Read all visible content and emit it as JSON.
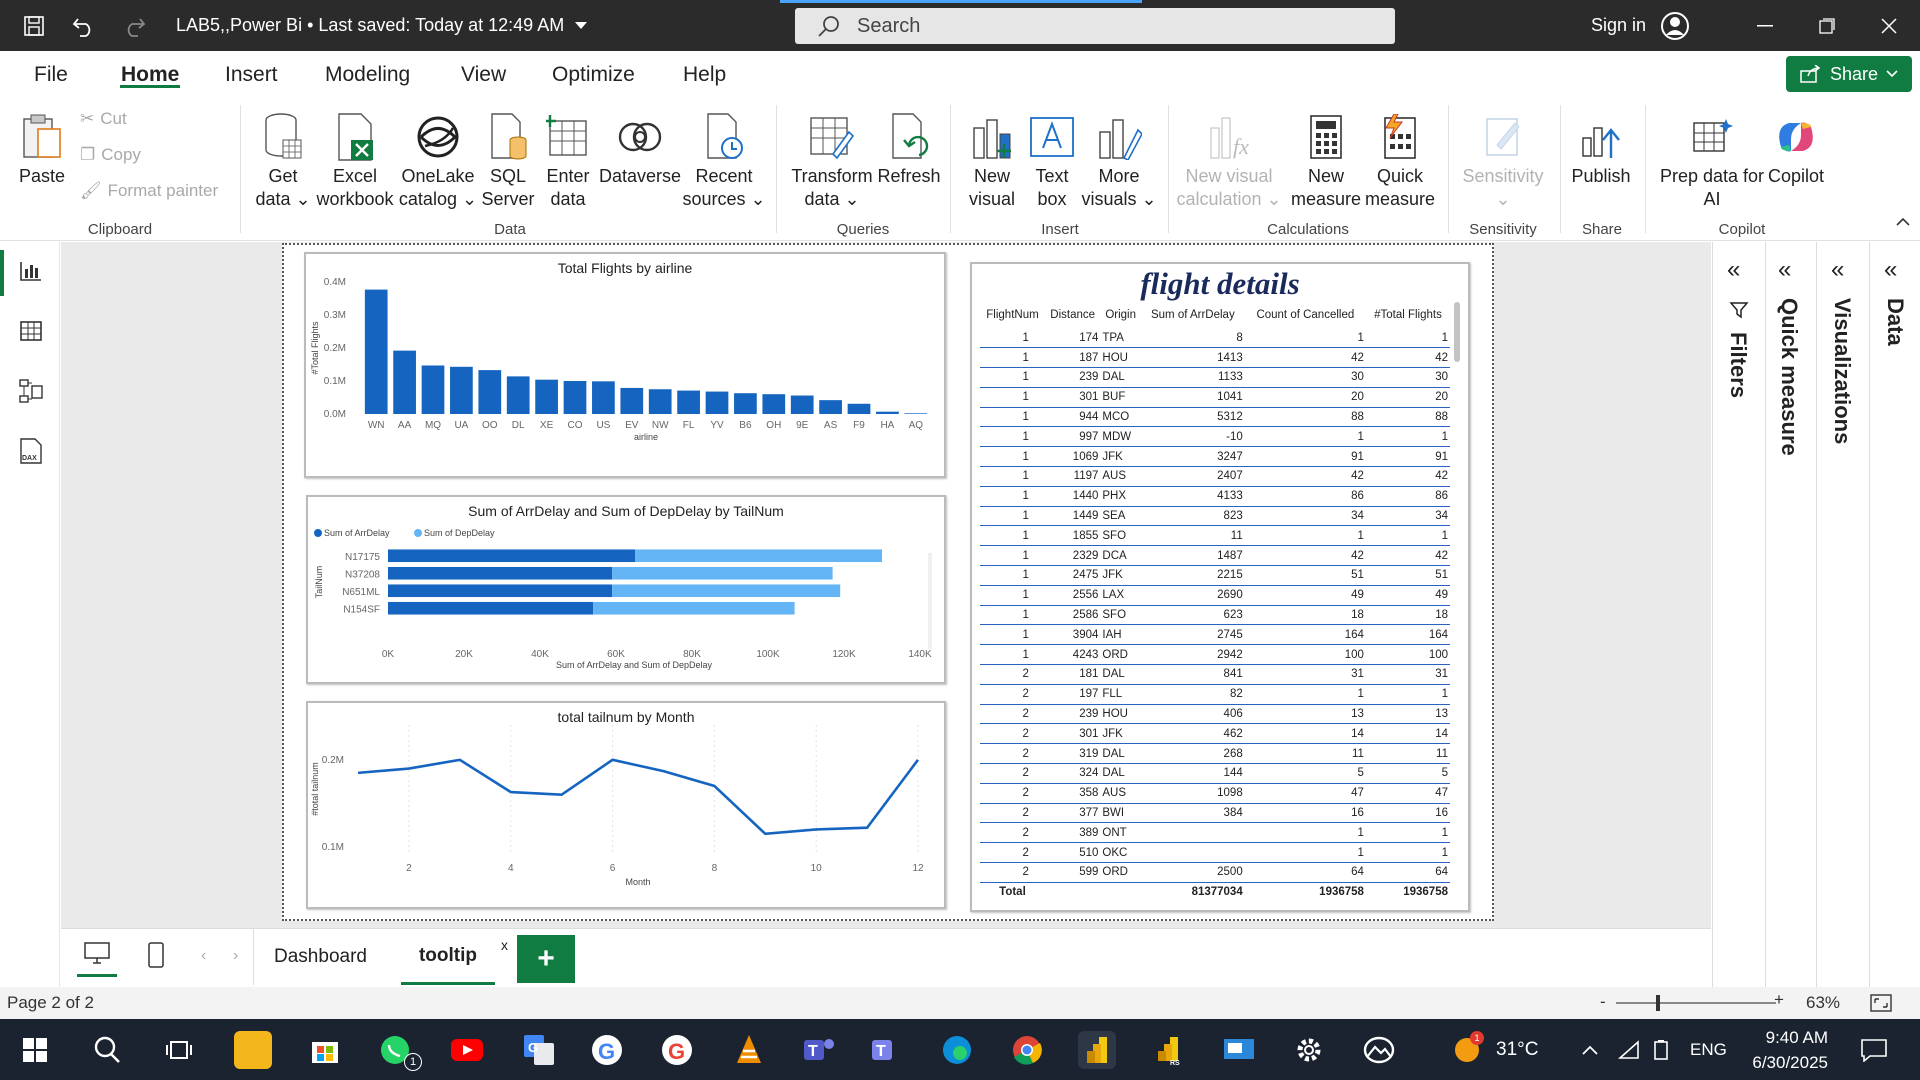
{
  "titlebar": {
    "doc_title": "LAB5,,Power Bi • Last saved: Today at 12:49 AM",
    "search_placeholder": "Search",
    "signin": "Sign in"
  },
  "menu": {
    "items": [
      "File",
      "Home",
      "Insert",
      "Modeling",
      "View",
      "Optimize",
      "Help"
    ],
    "active": "Home",
    "share": "Share"
  },
  "ribbon": {
    "clipboard": {
      "paste": "Paste",
      "cut": "Cut",
      "copy": "Copy",
      "format_painter": "Format painter",
      "group": "Clipboard"
    },
    "data": {
      "get_data": "Get\ndata ⌄",
      "excel": "Excel\nworkbook",
      "onelake": "OneLake\ncatalog ⌄",
      "sql": "SQL\nServer",
      "enter": "Enter\ndata",
      "dataverse": "Dataverse",
      "recent": "Recent\nsources ⌄",
      "group": "Data"
    },
    "queries": {
      "transform": "Transform\ndata ⌄",
      "refresh": "Refresh",
      "group": "Queries"
    },
    "insert": {
      "new_visual": "New\nvisual",
      "text_box": "Text\nbox",
      "more_visuals": "More\nvisuals ⌄",
      "group": "Insert"
    },
    "calculations": {
      "new_visual_calc": "New visual\ncalculation ⌄",
      "new_measure": "New\nmeasure",
      "quick_measure": "Quick\nmeasure",
      "group": "Calculations"
    },
    "sensitivity": {
      "label": "Sensitivity\n⌄",
      "group": "Sensitivity"
    },
    "share": {
      "publish": "Publish",
      "group": "Share"
    },
    "copilot": {
      "prep": "Prep data for\nAI",
      "copilot": "Copilot",
      "group": "Copilot"
    }
  },
  "panes": {
    "filters": "Filters",
    "quick_measure": "Quick measure",
    "visualizations": "Visualizations",
    "data": "Data"
  },
  "colors": {
    "accent": "#107c41",
    "bar_dark": "#1565c0",
    "bar_light": "#64b5f6",
    "table_rule": "#2a62c0"
  },
  "chart_data": [
    {
      "type": "bar",
      "title": "Total Flights by airline",
      "xlabel": "airline",
      "ylabel": "#Total Flights",
      "categories": [
        "WN",
        "AA",
        "MQ",
        "UA",
        "OO",
        "DL",
        "XE",
        "CO",
        "US",
        "EV",
        "NW",
        "FL",
        "YV",
        "B6",
        "OH",
        "9E",
        "AS",
        "F9",
        "HA",
        "AQ"
      ],
      "values": [
        377,
        192,
        147,
        143,
        133,
        114,
        104,
        100,
        99,
        79,
        75,
        71,
        68,
        63,
        60,
        56,
        42,
        31,
        7,
        2
      ],
      "ylim": [
        0,
        400
      ],
      "ytick_labels": [
        "0.0M",
        "0.1M",
        "0.2M",
        "0.3M",
        "0.4M"
      ],
      "ytick_values": [
        0,
        100,
        200,
        300,
        400
      ],
      "grid": false
    },
    {
      "type": "bar",
      "orientation": "horizontal",
      "stacked": true,
      "title": "Sum of ArrDelay and Sum of DepDelay by TailNum",
      "xlabel": "Sum of ArrDelay and Sum of DepDelay",
      "ylabel": "TailNum",
      "legend": "top-left",
      "categories": [
        "N17175",
        "N37208",
        "N651ML",
        "N154SF"
      ],
      "series": [
        {
          "name": "Sum of ArrDelay",
          "values": [
            65,
            59,
            59,
            54
          ]
        },
        {
          "name": "Sum of DepDelay",
          "values": [
            65,
            58,
            60,
            53
          ]
        }
      ],
      "xlim": [
        0,
        140
      ],
      "xtick_labels": [
        "0K",
        "20K",
        "40K",
        "60K",
        "80K",
        "100K",
        "120K",
        "140K"
      ],
      "xtick_values": [
        0,
        20,
        40,
        60,
        80,
        100,
        120,
        140
      ]
    },
    {
      "type": "line",
      "title": "total tailnum by Month",
      "xlabel": "Month",
      "ylabel": "#total tailnum",
      "x": [
        1,
        2,
        3,
        4,
        5,
        6,
        7,
        8,
        9,
        10,
        11,
        12
      ],
      "y": [
        0.185,
        0.19,
        0.2,
        0.163,
        0.16,
        0.2,
        0.187,
        0.17,
        0.115,
        0.12,
        0.122,
        0.2
      ],
      "ylim": [
        0.07,
        0.24
      ],
      "ytick_labels": [
        "0.1M",
        "0.2M"
      ],
      "ytick_values": [
        0.1,
        0.2
      ],
      "xtick_values": [
        2,
        4,
        6,
        8,
        10,
        12
      ]
    }
  ],
  "table": {
    "title": "flight details",
    "columns": [
      "FlightNum",
      "Distance",
      "Origin",
      "Sum of ArrDelay",
      "Count of Cancelled",
      "#Total Flights"
    ],
    "rows": [
      [
        "1",
        "174",
        "TPA",
        "8",
        "1",
        "1"
      ],
      [
        "1",
        "187",
        "HOU",
        "1413",
        "42",
        "42"
      ],
      [
        "1",
        "239",
        "DAL",
        "1133",
        "30",
        "30"
      ],
      [
        "1",
        "301",
        "BUF",
        "1041",
        "20",
        "20"
      ],
      [
        "1",
        "944",
        "MCO",
        "5312",
        "88",
        "88"
      ],
      [
        "1",
        "997",
        "MDW",
        "-10",
        "1",
        "1"
      ],
      [
        "1",
        "1069",
        "JFK",
        "3247",
        "91",
        "91"
      ],
      [
        "1",
        "1197",
        "AUS",
        "2407",
        "42",
        "42"
      ],
      [
        "1",
        "1440",
        "PHX",
        "4133",
        "86",
        "86"
      ],
      [
        "1",
        "1449",
        "SEA",
        "823",
        "34",
        "34"
      ],
      [
        "1",
        "1855",
        "SFO",
        "11",
        "1",
        "1"
      ],
      [
        "1",
        "2329",
        "DCA",
        "1487",
        "42",
        "42"
      ],
      [
        "1",
        "2475",
        "JFK",
        "2215",
        "51",
        "51"
      ],
      [
        "1",
        "2556",
        "LAX",
        "2690",
        "49",
        "49"
      ],
      [
        "1",
        "2586",
        "SFO",
        "623",
        "18",
        "18"
      ],
      [
        "1",
        "3904",
        "IAH",
        "2745",
        "164",
        "164"
      ],
      [
        "1",
        "4243",
        "ORD",
        "2942",
        "100",
        "100"
      ],
      [
        "2",
        "181",
        "DAL",
        "841",
        "31",
        "31"
      ],
      [
        "2",
        "197",
        "FLL",
        "82",
        "1",
        "1"
      ],
      [
        "2",
        "239",
        "HOU",
        "406",
        "13",
        "13"
      ],
      [
        "2",
        "301",
        "JFK",
        "462",
        "14",
        "14"
      ],
      [
        "2",
        "319",
        "DAL",
        "268",
        "11",
        "11"
      ],
      [
        "2",
        "324",
        "DAL",
        "144",
        "5",
        "5"
      ],
      [
        "2",
        "358",
        "AUS",
        "1098",
        "47",
        "47"
      ],
      [
        "2",
        "377",
        "BWI",
        "384",
        "16",
        "16"
      ],
      [
        "2",
        "389",
        "ONT",
        "",
        "1",
        "1"
      ],
      [
        "2",
        "510",
        "OKC",
        "",
        "1",
        "1"
      ],
      [
        "2",
        "599",
        "ORD",
        "2500",
        "64",
        "64"
      ]
    ],
    "total": [
      "Total",
      "",
      "",
      "81377034",
      "1936758",
      "1936758"
    ]
  },
  "tabs": {
    "dashboard": "Dashboard",
    "tooltip": "tooltip",
    "close": "x",
    "add": "+"
  },
  "status": {
    "page": "Page 2 of 2",
    "zoom": "63%",
    "zoom_minus": "-",
    "zoom_plus": "+"
  },
  "taskbar": {
    "temp": "31°C",
    "lang": "ENG",
    "time": "9:40 AM",
    "date": "6/30/2025",
    "whatsapp_badge": "1",
    "weather_badge": "1"
  }
}
